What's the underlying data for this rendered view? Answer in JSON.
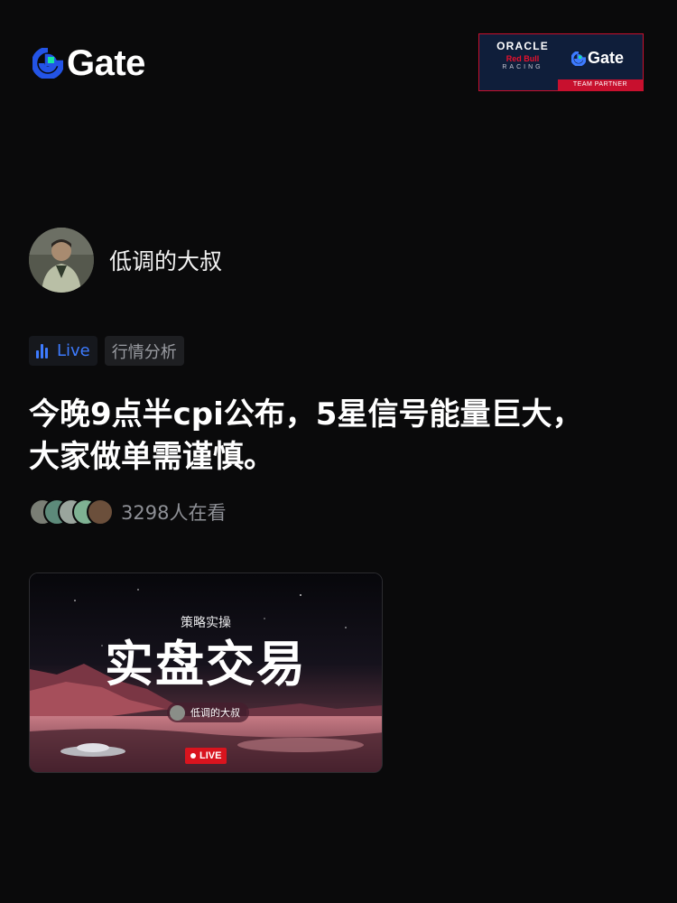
{
  "header": {
    "logo_text": "Gate",
    "partner": {
      "oracle": "ORACLE",
      "redbull": "Red Bull",
      "racing": "RACING",
      "gate": "Gate",
      "team_partner": "TEAM PARTNER"
    }
  },
  "author": {
    "name": "低调的大叔",
    "icon": "avatar-photo"
  },
  "tags": [
    {
      "label": "Live",
      "icon": "bar-chart-icon",
      "color": "#3d7bff"
    },
    {
      "label": "行情分析"
    }
  ],
  "post": {
    "title": "今晚9点半cpi公布，5星信号能量巨大，大家做单需谨慎。"
  },
  "viewers": {
    "count_text": "3298人在看"
  },
  "card": {
    "subtitle": "策略实操",
    "headline": "实盘交易",
    "host": "低调的大叔",
    "live_label": "LIVE",
    "accent": "#d9141e"
  },
  "colors": {
    "background": "#0a0a0b",
    "brand_blue": "#2354e6",
    "brand_green": "#17e6a1"
  }
}
